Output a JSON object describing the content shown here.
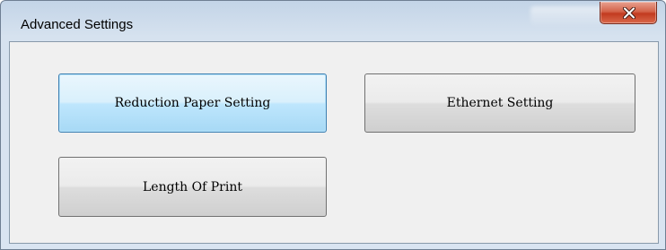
{
  "window": {
    "title": "Advanced Settings"
  },
  "titlebar": {
    "close_icon": "close-icon"
  },
  "buttons": {
    "reduction_paper_setting": "Reduction Paper Setting",
    "ethernet_setting": "Ethernet Setting",
    "length_of_print": "Length Of Print"
  },
  "colors": {
    "titlebar": "#c3d4e7",
    "client_background": "#f0f0f0",
    "close_button": "#c23b20",
    "focused_button_border": "#3c7fb1"
  }
}
